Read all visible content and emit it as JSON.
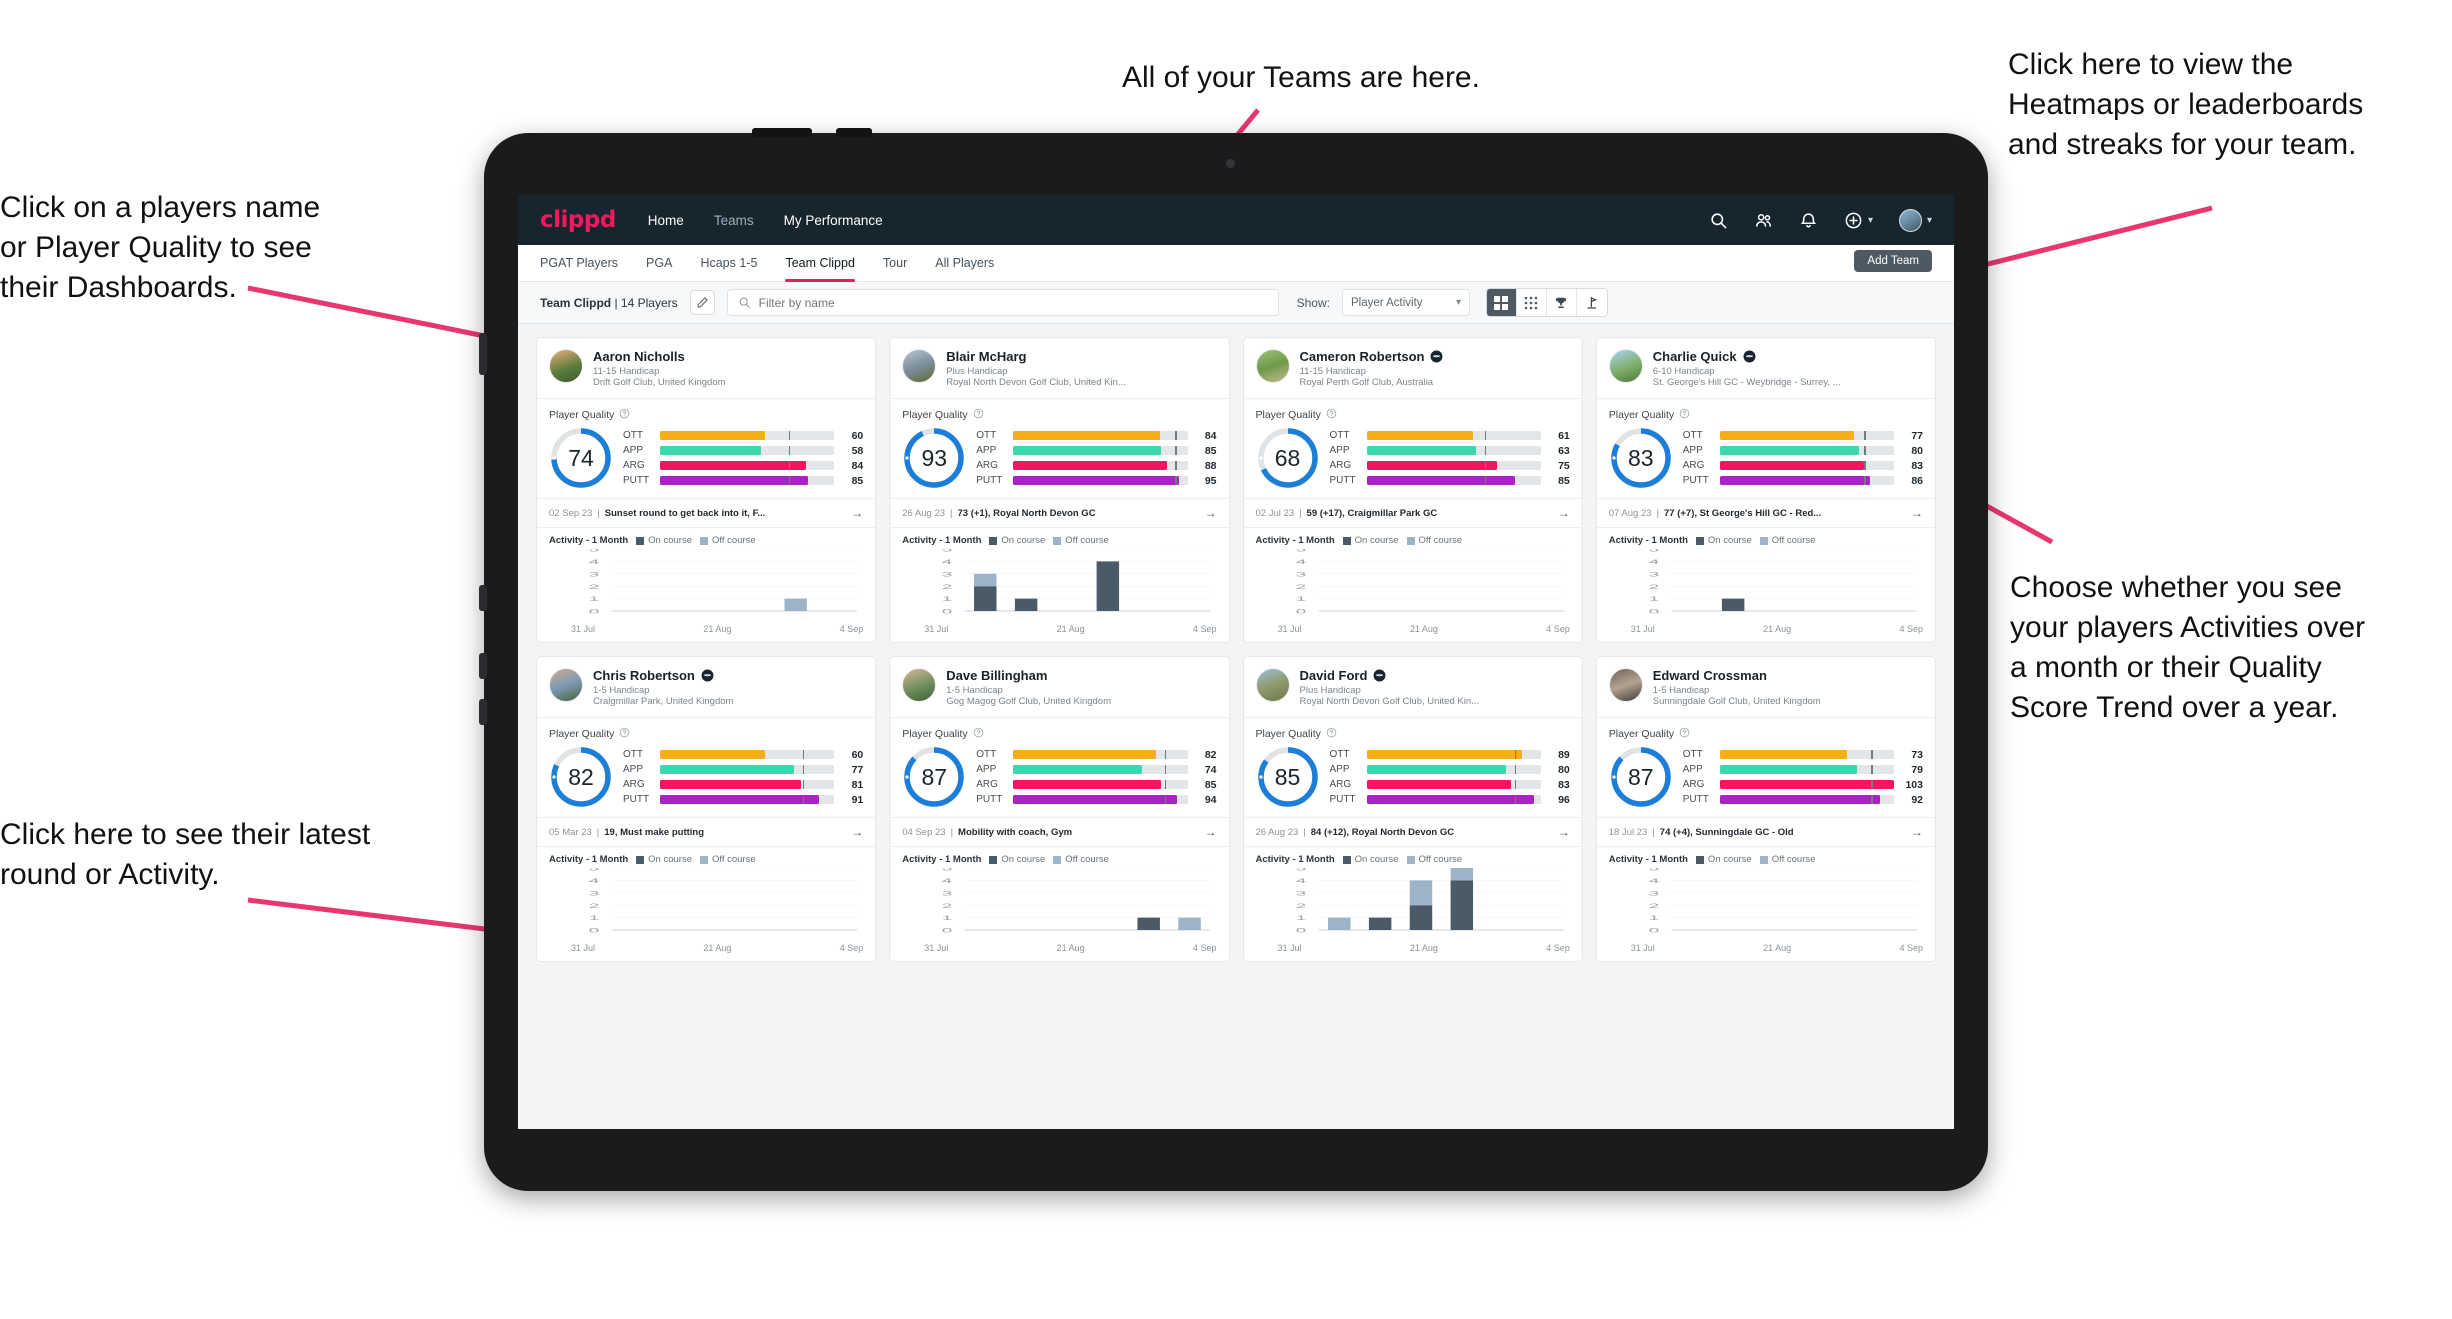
{
  "annotations": [
    {
      "id": "players-name",
      "text": "Click on a players name\nor Player Quality to see\ntheir Dashboards."
    },
    {
      "id": "teams",
      "text": "All of your Teams are here."
    },
    {
      "id": "heatmaps",
      "text": "Click here to view the\nHeatmaps or leaderboards\nand streaks for your team."
    },
    {
      "id": "activity-choice",
      "text": "Choose whether you see\nyour players Activities over\na month or their Quality\nScore Trend over a year."
    },
    {
      "id": "latest-round",
      "text": "Click here to see their latest\nround or Activity."
    }
  ],
  "app": {
    "logo": "clippd",
    "nav": [
      {
        "label": "Home",
        "active": true
      },
      {
        "label": "Teams",
        "active": false
      },
      {
        "label": "My Performance",
        "active": true
      }
    ],
    "tabs": [
      {
        "label": "PGAT Players",
        "active": false
      },
      {
        "label": "PGA",
        "active": false
      },
      {
        "label": "Hcaps 1-5",
        "active": false
      },
      {
        "label": "Team Clippd",
        "active": true
      },
      {
        "label": "Tour",
        "active": false
      },
      {
        "label": "All Players",
        "active": false
      }
    ],
    "add_team_label": "Add Team",
    "toolbar": {
      "team_name": "Team Clippd",
      "team_separator": " | ",
      "team_count": "14 Players",
      "search_placeholder": "Filter by name",
      "show_label": "Show:",
      "show_value": "Player Activity",
      "views": [
        {
          "name": "grid-view",
          "active": true
        },
        {
          "name": "dots-view",
          "active": false
        },
        {
          "name": "trophy-view",
          "active": false
        },
        {
          "name": "course-view",
          "active": false
        }
      ]
    },
    "colors": {
      "brand_pink": "#ef1a5c",
      "header_navy": "#16252e",
      "ring_blue": "#1d7ed8",
      "ott": "#f5ad18",
      "app": "#3ed6ae",
      "arg": "#f5145f",
      "putt": "#aa22c4",
      "on_course": "#4a5a66",
      "off_course": "#9db4c8"
    },
    "labels": {
      "player_quality": "Player Quality",
      "activity": "Activity - 1 Month",
      "legend_on": "On course",
      "legend_off": "Off course",
      "stat_rows": [
        "OTT",
        "APP",
        "ARG",
        "PUTT"
      ]
    }
  },
  "players": [
    {
      "name": "Aaron Nicholls",
      "verified": false,
      "handicap": "11-15 Handicap",
      "club": "Drift Golf Club, United Kingdom",
      "quality": 74,
      "stats": [
        {
          "label": "OTT",
          "value": 60,
          "pct": 60,
          "mark": 74
        },
        {
          "label": "APP",
          "value": 58,
          "pct": 58,
          "mark": 74
        },
        {
          "label": "ARG",
          "value": 84,
          "pct": 84,
          "mark": 74
        },
        {
          "label": "PUTT",
          "value": 85,
          "pct": 85,
          "mark": 74
        }
      ],
      "round_date": "02 Sep 23",
      "round_text": "Sunset round to get back into it, F...",
      "chart_data": {
        "type": "bar",
        "title": "Activity - 1 Month",
        "categories": [
          "31 Jul",
          "21 Aug",
          "4 Sep"
        ],
        "ylim": [
          0,
          5
        ],
        "yticks": [
          0,
          1,
          2,
          3,
          4,
          5
        ],
        "series": [
          {
            "name": "On course",
            "values": [
              0,
              0,
              0,
              0,
              0,
              0
            ]
          },
          {
            "name": "Off course",
            "values": [
              0,
              0,
              0,
              0,
              1,
              0
            ]
          }
        ]
      }
    },
    {
      "name": "Blair McHarg",
      "verified": false,
      "handicap": "Plus Handicap",
      "club": "Royal North Devon Golf Club, United Kin...",
      "quality": 93,
      "stats": [
        {
          "label": "OTT",
          "value": 84,
          "pct": 84,
          "mark": 93
        },
        {
          "label": "APP",
          "value": 85,
          "pct": 85,
          "mark": 93
        },
        {
          "label": "ARG",
          "value": 88,
          "pct": 88,
          "mark": 93
        },
        {
          "label": "PUTT",
          "value": 95,
          "pct": 95,
          "mark": 93
        }
      ],
      "round_date": "26 Aug 23",
      "round_text": "73 (+1), Royal North Devon GC",
      "chart_data": {
        "type": "bar",
        "title": "Activity - 1 Month",
        "categories": [
          "31 Jul",
          "21 Aug",
          "4 Sep"
        ],
        "ylim": [
          0,
          5
        ],
        "yticks": [
          0,
          1,
          2,
          3,
          4,
          5
        ],
        "series": [
          {
            "name": "On course",
            "values": [
              2,
              1,
              0,
              4,
              0,
              0
            ]
          },
          {
            "name": "Off course",
            "values": [
              1,
              0,
              0,
              0,
              0,
              0
            ]
          }
        ]
      }
    },
    {
      "name": "Cameron Robertson",
      "verified": true,
      "handicap": "11-15 Handicap",
      "club": "Royal Perth Golf Club, Australia",
      "quality": 68,
      "stats": [
        {
          "label": "OTT",
          "value": 61,
          "pct": 61,
          "mark": 68
        },
        {
          "label": "APP",
          "value": 63,
          "pct": 63,
          "mark": 68
        },
        {
          "label": "ARG",
          "value": 75,
          "pct": 75,
          "mark": 68
        },
        {
          "label": "PUTT",
          "value": 85,
          "pct": 85,
          "mark": 68
        }
      ],
      "round_date": "02 Jul 23",
      "round_text": "59 (+17), Craigmillar Park GC",
      "chart_data": {
        "type": "bar",
        "title": "Activity - 1 Month",
        "categories": [
          "31 Jul",
          "21 Aug",
          "4 Sep"
        ],
        "ylim": [
          0,
          5
        ],
        "yticks": [
          0,
          1,
          2,
          3,
          4,
          5
        ],
        "series": [
          {
            "name": "On course",
            "values": [
              0,
              0,
              0,
              0,
              0,
              0
            ]
          },
          {
            "name": "Off course",
            "values": [
              0,
              0,
              0,
              0,
              0,
              0
            ]
          }
        ]
      }
    },
    {
      "name": "Charlie Quick",
      "verified": true,
      "handicap": "6-10 Handicap",
      "club": "St. George's Hill GC - Weybridge - Surrey, ...",
      "quality": 83,
      "stats": [
        {
          "label": "OTT",
          "value": 77,
          "pct": 77,
          "mark": 83
        },
        {
          "label": "APP",
          "value": 80,
          "pct": 80,
          "mark": 83
        },
        {
          "label": "ARG",
          "value": 83,
          "pct": 83,
          "mark": 83
        },
        {
          "label": "PUTT",
          "value": 86,
          "pct": 86,
          "mark": 83
        }
      ],
      "round_date": "07 Aug 23",
      "round_text": "77 (+7), St George's Hill GC - Red...",
      "chart_data": {
        "type": "bar",
        "title": "Activity - 1 Month",
        "categories": [
          "31 Jul",
          "21 Aug",
          "4 Sep"
        ],
        "ylim": [
          0,
          5
        ],
        "yticks": [
          0,
          1,
          2,
          3,
          4,
          5
        ],
        "series": [
          {
            "name": "On course",
            "values": [
              0,
              1,
              0,
              0,
              0,
              0
            ]
          },
          {
            "name": "Off course",
            "values": [
              0,
              0,
              0,
              0,
              0,
              0
            ]
          }
        ]
      }
    },
    {
      "name": "Chris Robertson",
      "verified": true,
      "handicap": "1-5 Handicap",
      "club": "Craigmillar Park, United Kingdom",
      "quality": 82,
      "stats": [
        {
          "label": "OTT",
          "value": 60,
          "pct": 60,
          "mark": 82
        },
        {
          "label": "APP",
          "value": 77,
          "pct": 77,
          "mark": 82
        },
        {
          "label": "ARG",
          "value": 81,
          "pct": 81,
          "mark": 82
        },
        {
          "label": "PUTT",
          "value": 91,
          "pct": 91,
          "mark": 82
        }
      ],
      "round_date": "05 Mar 23",
      "round_text": "19, Must make putting",
      "chart_data": {
        "type": "bar",
        "title": "Activity - 1 Month",
        "categories": [
          "31 Jul",
          "21 Aug",
          "4 Sep"
        ],
        "ylim": [
          0,
          5
        ],
        "yticks": [
          0,
          1,
          2,
          3,
          4,
          5
        ],
        "series": [
          {
            "name": "On course",
            "values": [
              0,
              0,
              0,
              0,
              0,
              0
            ]
          },
          {
            "name": "Off course",
            "values": [
              0,
              0,
              0,
              0,
              0,
              0
            ]
          }
        ]
      }
    },
    {
      "name": "Dave Billingham",
      "verified": false,
      "handicap": "1-5 Handicap",
      "club": "Gog Magog Golf Club, United Kingdom",
      "quality": 87,
      "stats": [
        {
          "label": "OTT",
          "value": 82,
          "pct": 82,
          "mark": 87
        },
        {
          "label": "APP",
          "value": 74,
          "pct": 74,
          "mark": 87
        },
        {
          "label": "ARG",
          "value": 85,
          "pct": 85,
          "mark": 87
        },
        {
          "label": "PUTT",
          "value": 94,
          "pct": 94,
          "mark": 87
        }
      ],
      "round_date": "04 Sep 23",
      "round_text": "Mobility with coach, Gym",
      "chart_data": {
        "type": "bar",
        "title": "Activity - 1 Month",
        "categories": [
          "31 Jul",
          "21 Aug",
          "4 Sep"
        ],
        "ylim": [
          0,
          5
        ],
        "yticks": [
          0,
          1,
          2,
          3,
          4,
          5
        ],
        "series": [
          {
            "name": "On course",
            "values": [
              0,
              0,
              0,
              0,
              1,
              0
            ]
          },
          {
            "name": "Off course",
            "values": [
              0,
              0,
              0,
              0,
              0,
              1
            ]
          }
        ]
      }
    },
    {
      "name": "David Ford",
      "verified": true,
      "handicap": "Plus Handicap",
      "club": "Royal North Devon Golf Club, United Kin...",
      "quality": 85,
      "stats": [
        {
          "label": "OTT",
          "value": 89,
          "pct": 89,
          "mark": 85
        },
        {
          "label": "APP",
          "value": 80,
          "pct": 80,
          "mark": 85
        },
        {
          "label": "ARG",
          "value": 83,
          "pct": 83,
          "mark": 85
        },
        {
          "label": "PUTT",
          "value": 96,
          "pct": 96,
          "mark": 85
        }
      ],
      "round_date": "26 Aug 23",
      "round_text": "84 (+12), Royal North Devon GC",
      "chart_data": {
        "type": "bar",
        "title": "Activity - 1 Month",
        "categories": [
          "31 Jul",
          "21 Aug",
          "4 Sep"
        ],
        "ylim": [
          0,
          5
        ],
        "yticks": [
          0,
          1,
          2,
          3,
          4,
          5
        ],
        "series": [
          {
            "name": "On course",
            "values": [
              0,
              1,
              2,
              4,
              0,
              0
            ]
          },
          {
            "name": "Off course",
            "values": [
              1,
              0,
              2,
              1,
              0,
              0
            ]
          }
        ]
      }
    },
    {
      "name": "Edward Crossman",
      "verified": false,
      "handicap": "1-5 Handicap",
      "club": "Sunningdale Golf Club, United Kingdom",
      "quality": 87,
      "stats": [
        {
          "label": "OTT",
          "value": 73,
          "pct": 73,
          "mark": 87
        },
        {
          "label": "APP",
          "value": 79,
          "pct": 79,
          "mark": 87
        },
        {
          "label": "ARG",
          "value": 103,
          "pct": 100,
          "mark": 87
        },
        {
          "label": "PUTT",
          "value": 92,
          "pct": 92,
          "mark": 87
        }
      ],
      "round_date": "18 Jul 23",
      "round_text": "74 (+4), Sunningdale GC - Old",
      "chart_data": {
        "type": "bar",
        "title": "Activity - 1 Month",
        "categories": [
          "31 Jul",
          "21 Aug",
          "4 Sep"
        ],
        "ylim": [
          0,
          5
        ],
        "yticks": [
          0,
          1,
          2,
          3,
          4,
          5
        ],
        "series": [
          {
            "name": "On course",
            "values": [
              0,
              0,
              0,
              0,
              0,
              0
            ]
          },
          {
            "name": "Off course",
            "values": [
              0,
              0,
              0,
              0,
              0,
              0
            ]
          }
        ]
      }
    }
  ]
}
